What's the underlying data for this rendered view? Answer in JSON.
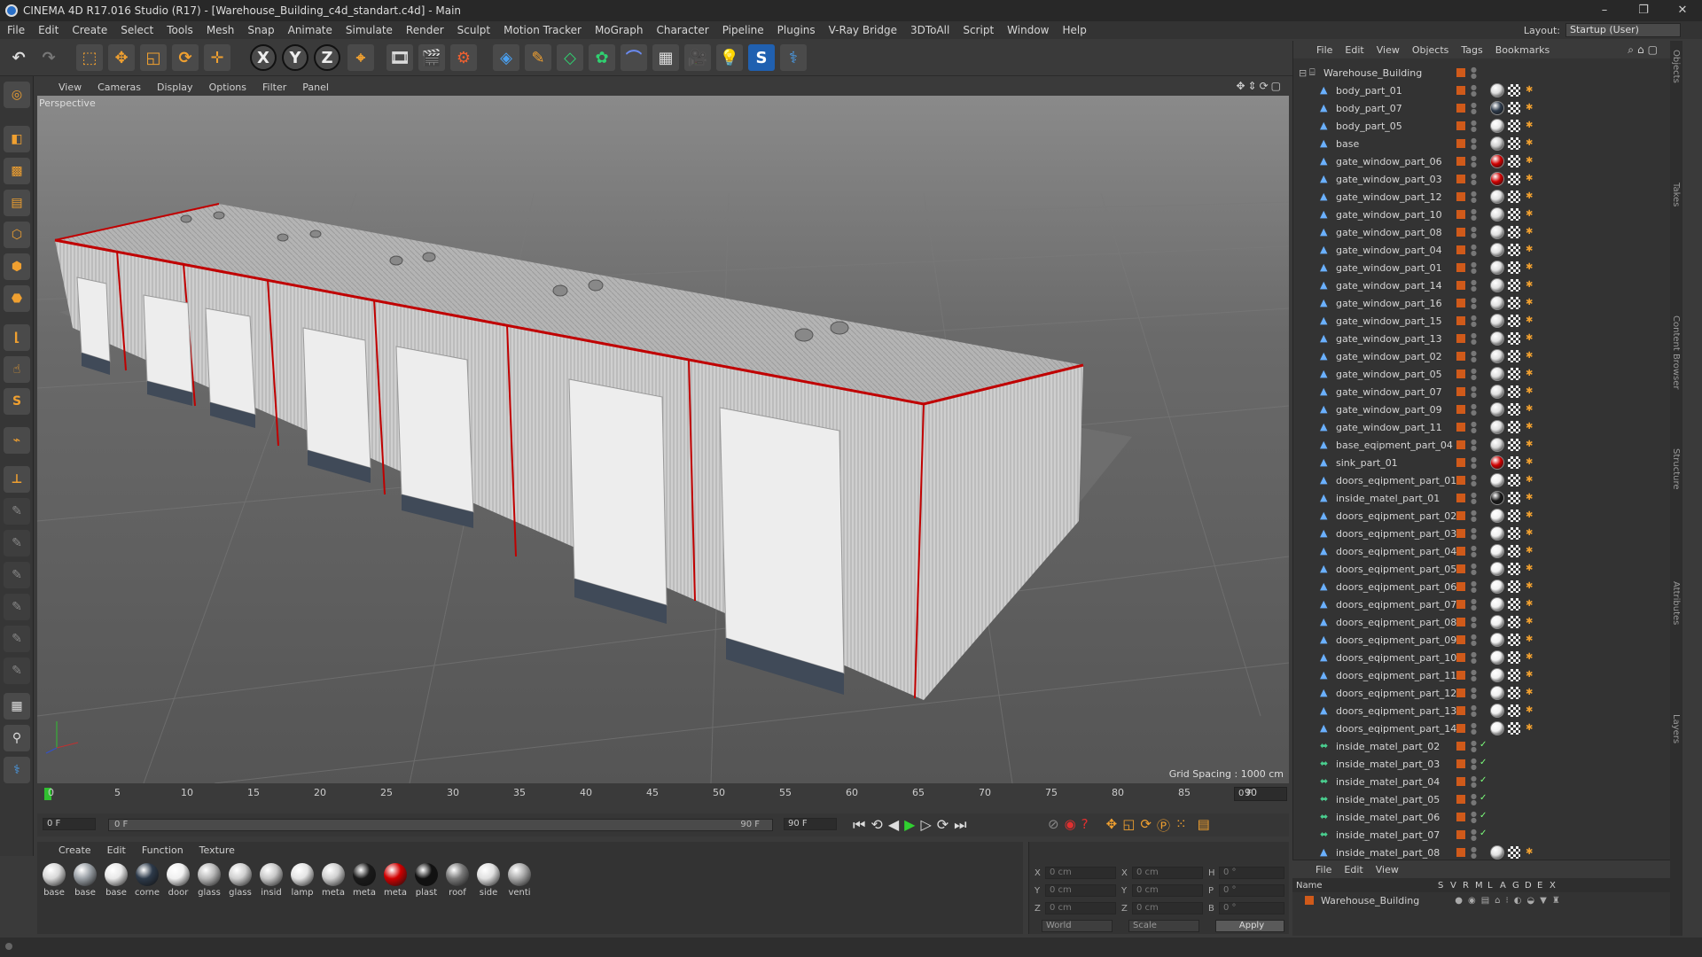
{
  "titlebar": {
    "title": "CINEMA 4D R17.016 Studio (R17) - [Warehouse_Building_c4d_standart.c4d] - Main",
    "min": "–",
    "max": "❐",
    "close": "✕"
  },
  "menubar": [
    "File",
    "Edit",
    "Create",
    "Select",
    "Tools",
    "Mesh",
    "Snap",
    "Animate",
    "Simulate",
    "Render",
    "Sculpt",
    "Motion Tracker",
    "MoGraph",
    "Character",
    "Pipeline",
    "Plugins",
    "V-Ray Bridge",
    "3DToAll",
    "Script",
    "Window",
    "Help"
  ],
  "layout": {
    "label": "Layout:",
    "value": "Startup (User)"
  },
  "viewport": {
    "menu": [
      "View",
      "Cameras",
      "Display",
      "Options",
      "Filter",
      "Panel"
    ],
    "label": "Perspective",
    "grid": "Grid Spacing : 1000 cm",
    "nav": "✥⇕⟳▢"
  },
  "timeline": {
    "ticks": [
      "0",
      "5",
      "10",
      "15",
      "20",
      "25",
      "30",
      "35",
      "40",
      "45",
      "50",
      "55",
      "60",
      "65",
      "70",
      "75",
      "80",
      "85",
      "90"
    ],
    "frame_right": "0 F",
    "start": "0 F",
    "range_start": "0 F",
    "range_end": "90 F",
    "end": "90 F"
  },
  "materials": {
    "menu": [
      "Create",
      "Edit",
      "Function",
      "Texture"
    ],
    "items": [
      {
        "name": "base",
        "color": "#d8d8d8"
      },
      {
        "name": "base",
        "color": "#9aa0a6"
      },
      {
        "name": "base",
        "color": "#e8e8e8"
      },
      {
        "name": "corne",
        "color": "#2d3a4a"
      },
      {
        "name": "door",
        "color": "#f0f0f0"
      },
      {
        "name": "glass",
        "color": "#b8b8b8"
      },
      {
        "name": "glass",
        "color": "#cfcfcf"
      },
      {
        "name": "insid",
        "color": "#c8c8c8"
      },
      {
        "name": "lamp",
        "color": "#e4e4e4"
      },
      {
        "name": "meta",
        "color": "#d0d0d0"
      },
      {
        "name": "meta",
        "color": "#1a1a1a"
      },
      {
        "name": "meta",
        "color": "#d00000"
      },
      {
        "name": "plast",
        "color": "#111111"
      },
      {
        "name": "roof",
        "color": "#7a7a7a"
      },
      {
        "name": "side",
        "color": "#e0e0e0"
      },
      {
        "name": "venti",
        "color": "#aaaaaa"
      }
    ]
  },
  "coords": {
    "x": "0 cm",
    "y": "0 cm",
    "z": "0 cm",
    "sx": "0 cm",
    "sy": "0 cm",
    "sz": "0 cm",
    "h": "0 °",
    "p": "0 °",
    "b": "0 °",
    "world": "World",
    "scale": "Scale",
    "apply": "Apply"
  },
  "objects": {
    "menu": [
      "File",
      "Edit",
      "View",
      "Objects",
      "Tags",
      "Bookmarks"
    ],
    "root": "Warehouse_Building",
    "items": [
      {
        "name": "body_part_01",
        "mat": "#dcdcdc",
        "kind": "poly"
      },
      {
        "name": "body_part_07",
        "mat": "#2d3a4a",
        "kind": "poly"
      },
      {
        "name": "body_part_05",
        "mat": "#e8e8e8",
        "kind": "poly"
      },
      {
        "name": "base",
        "mat": "#cfcfcf",
        "kind": "poly"
      },
      {
        "name": "gate_window_part_06",
        "mat": "#d00000",
        "kind": "poly"
      },
      {
        "name": "gate_window_part_03",
        "mat": "#d00000",
        "kind": "poly"
      },
      {
        "name": "gate_window_part_12",
        "mat": "#e0e0e0",
        "kind": "poly"
      },
      {
        "name": "gate_window_part_10",
        "mat": "#e0e0e0",
        "kind": "poly"
      },
      {
        "name": "gate_window_part_08",
        "mat": "#e0e0e0",
        "kind": "poly"
      },
      {
        "name": "gate_window_part_04",
        "mat": "#e0e0e0",
        "kind": "poly"
      },
      {
        "name": "gate_window_part_01",
        "mat": "#e0e0e0",
        "kind": "poly"
      },
      {
        "name": "gate_window_part_14",
        "mat": "#e0e0e0",
        "kind": "poly"
      },
      {
        "name": "gate_window_part_16",
        "mat": "#e0e0e0",
        "kind": "poly"
      },
      {
        "name": "gate_window_part_15",
        "mat": "#e0e0e0",
        "kind": "poly"
      },
      {
        "name": "gate_window_part_13",
        "mat": "#e0e0e0",
        "kind": "poly"
      },
      {
        "name": "gate_window_part_02",
        "mat": "#e0e0e0",
        "kind": "poly"
      },
      {
        "name": "gate_window_part_05",
        "mat": "#e0e0e0",
        "kind": "poly"
      },
      {
        "name": "gate_window_part_07",
        "mat": "#e0e0e0",
        "kind": "poly"
      },
      {
        "name": "gate_window_part_09",
        "mat": "#e0e0e0",
        "kind": "poly"
      },
      {
        "name": "gate_window_part_11",
        "mat": "#e0e0e0",
        "kind": "poly"
      },
      {
        "name": "base_eqipment_part_04",
        "mat": "#d8d8d8",
        "kind": "poly"
      },
      {
        "name": "sink_part_01",
        "mat": "#d00000",
        "kind": "poly"
      },
      {
        "name": "doors_eqipment_part_01",
        "mat": "#f0f0f0",
        "kind": "poly"
      },
      {
        "name": "inside_matel_part_01",
        "mat": "#1a1a1a",
        "kind": "poly"
      },
      {
        "name": "doors_eqipment_part_02",
        "mat": "#f0f0f0",
        "kind": "poly"
      },
      {
        "name": "doors_eqipment_part_03",
        "mat": "#f0f0f0",
        "kind": "poly"
      },
      {
        "name": "doors_eqipment_part_04",
        "mat": "#f0f0f0",
        "kind": "poly"
      },
      {
        "name": "doors_eqipment_part_05",
        "mat": "#f0f0f0",
        "kind": "poly"
      },
      {
        "name": "doors_eqipment_part_06",
        "mat": "#f0f0f0",
        "kind": "poly"
      },
      {
        "name": "doors_eqipment_part_07",
        "mat": "#f0f0f0",
        "kind": "poly"
      },
      {
        "name": "doors_eqipment_part_08",
        "mat": "#f0f0f0",
        "kind": "poly"
      },
      {
        "name": "doors_eqipment_part_09",
        "mat": "#f0f0f0",
        "kind": "poly"
      },
      {
        "name": "doors_eqipment_part_10",
        "mat": "#f0f0f0",
        "kind": "poly"
      },
      {
        "name": "doors_eqipment_part_11",
        "mat": "#f0f0f0",
        "kind": "poly"
      },
      {
        "name": "doors_eqipment_part_12",
        "mat": "#f0f0f0",
        "kind": "poly"
      },
      {
        "name": "doors_eqipment_part_13",
        "mat": "#f0f0f0",
        "kind": "poly"
      },
      {
        "name": "doors_eqipment_part_14",
        "mat": "#f0f0f0",
        "kind": "poly"
      },
      {
        "name": "inside_matel_part_02",
        "mat": "",
        "kind": "instance"
      },
      {
        "name": "inside_matel_part_03",
        "mat": "",
        "kind": "instance"
      },
      {
        "name": "inside_matel_part_04",
        "mat": "",
        "kind": "instance"
      },
      {
        "name": "inside_matel_part_05",
        "mat": "",
        "kind": "instance"
      },
      {
        "name": "inside_matel_part_06",
        "mat": "",
        "kind": "instance"
      },
      {
        "name": "inside_matel_part_07",
        "mat": "",
        "kind": "instance"
      },
      {
        "name": "inside_matel_part_08",
        "mat": "#e0e0e0",
        "kind": "poly"
      }
    ]
  },
  "layers": {
    "menu": [
      "File",
      "Edit",
      "View"
    ],
    "headers": [
      "Name",
      "S",
      "V",
      "R",
      "M",
      "L",
      "A",
      "G",
      "D",
      "E",
      "X"
    ],
    "row": "Warehouse_Building"
  },
  "side_tabs": [
    "Objects",
    "Takes",
    "Content Browser",
    "Structure",
    "Attributes",
    "Layers"
  ],
  "colors": {
    "accent": "#f0a030",
    "red_edge": "#c00000",
    "panel": "#333333",
    "layer": "#d05a1a"
  }
}
